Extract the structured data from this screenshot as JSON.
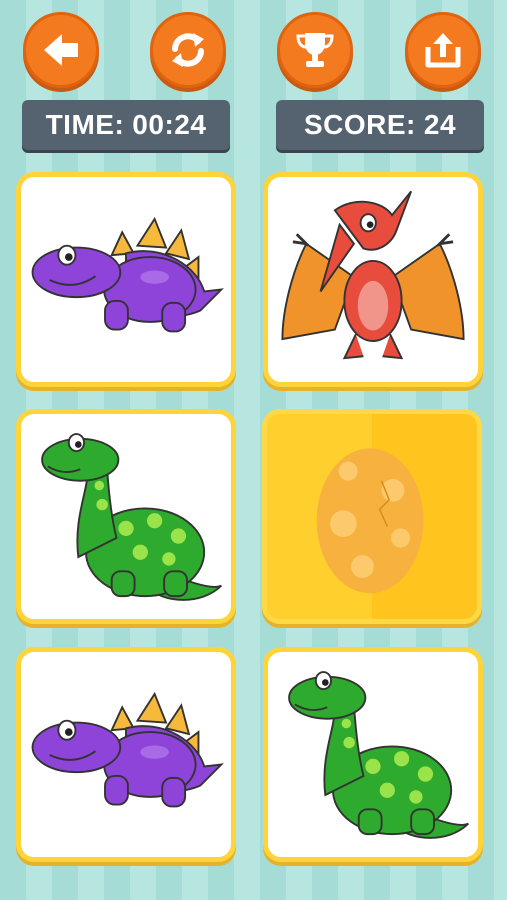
{
  "toolbar": {
    "back": "back-arrow-icon",
    "restart": "refresh-icon",
    "leaderboard": "trophy-icon",
    "share": "share-icon"
  },
  "status": {
    "time_label": "TIME:",
    "time_value": "00:24",
    "score_label": "SCORE:",
    "score_value": "24"
  },
  "cards": [
    {
      "id": 1,
      "state": "face-up",
      "character": "purple-stegosaurus"
    },
    {
      "id": 2,
      "state": "face-up",
      "character": "red-pterodactyl"
    },
    {
      "id": 3,
      "state": "face-up",
      "character": "green-brontosaurus"
    },
    {
      "id": 4,
      "state": "face-down",
      "character": "egg"
    },
    {
      "id": 5,
      "state": "face-up",
      "character": "purple-stegosaurus"
    },
    {
      "id": 6,
      "state": "face-up",
      "character": "green-brontosaurus"
    }
  ],
  "colors": {
    "button": "#f47a20",
    "info_bar": "#556270",
    "card_border": "#ffd43a",
    "card_back": "#ffcf2e",
    "egg": "#f7b13f"
  }
}
